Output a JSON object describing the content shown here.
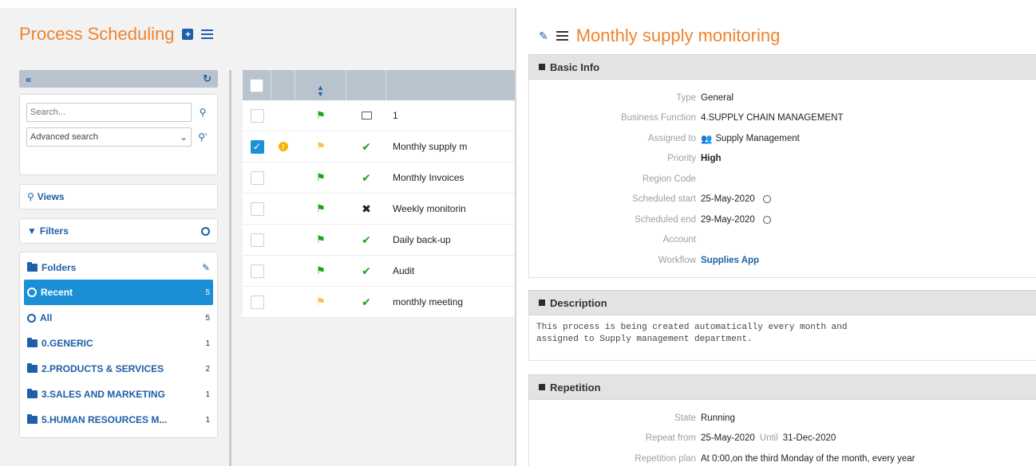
{
  "left": {
    "title": "Process Scheduling",
    "search_placeholder": "Search...",
    "advanced_search": "Advanced search",
    "views_label": "Views",
    "filters_label": "Filters",
    "folders_label": "Folders",
    "folders": [
      {
        "label": "Recent",
        "count": "5"
      },
      {
        "label": "All",
        "count": "5"
      },
      {
        "label": "0.GENERIC",
        "count": "1"
      },
      {
        "label": "2.PRODUCTS & SERVICES",
        "count": "2"
      },
      {
        "label": "3.SALES AND MARKETING",
        "count": "1"
      },
      {
        "label": "5.HUMAN RESOURCES M...",
        "count": "1"
      }
    ]
  },
  "grid": {
    "rows": [
      {
        "name": "1",
        "flag": "green",
        "status": "monitor-icon",
        "checked": false,
        "warning": false
      },
      {
        "name": "Monthly supply m",
        "flag": "yellow",
        "status": "check-icon",
        "checked": true,
        "warning": true
      },
      {
        "name": "Monthly Invoices",
        "flag": "green",
        "status": "check-icon",
        "checked": false,
        "warning": false
      },
      {
        "name": "Weekly monitorin",
        "flag": "green",
        "status": "x-icon",
        "checked": false,
        "warning": false
      },
      {
        "name": "Daily back-up",
        "flag": "green",
        "status": "check-icon",
        "checked": false,
        "warning": false
      },
      {
        "name": "Audit",
        "flag": "green",
        "status": "check-icon",
        "checked": false,
        "warning": false
      },
      {
        "name": "monthly meeting",
        "flag": "yellow",
        "status": "check-icon",
        "checked": false,
        "warning": false
      }
    ]
  },
  "detail": {
    "title": "Monthly supply monitoring",
    "basic_info": {
      "heading": "Basic Info",
      "type_label": "Type",
      "type": "General",
      "business_function_label": "Business Function",
      "business_function": "4.SUPPLY CHAIN MANAGEMENT",
      "assigned_to_label": "Assigned to",
      "assigned_to": "Supply Management",
      "priority_label": "Priority",
      "priority": "High",
      "region_code_label": "Region Code",
      "region_code": "",
      "scheduled_start_label": "Scheduled start",
      "scheduled_start": "25-May-2020",
      "scheduled_end_label": "Scheduled end",
      "scheduled_end": "29-May-2020",
      "account_label": "Account",
      "account": "",
      "workflow_label": "Workflow",
      "workflow": "Supplies App"
    },
    "description": {
      "heading": "Description",
      "text": "This process is being created automatically every month and\nassigned to Supply management department."
    },
    "repetition": {
      "heading": "Repetition",
      "state_label": "State",
      "state": "Running",
      "repeat_from_label": "Repeat from",
      "repeat_from": "25-May-2020",
      "until_label": "Until",
      "until": "31-Dec-2020",
      "plan_label": "Repetition plan",
      "plan": "At 0:00,on the third Monday of the month, every year"
    }
  },
  "colors": {
    "accent": "#f0832c",
    "primary": "#1d5fa8",
    "active": "#1d8fd6",
    "flag_green": "#1aa51a",
    "flag_yellow": "#f5c542"
  }
}
